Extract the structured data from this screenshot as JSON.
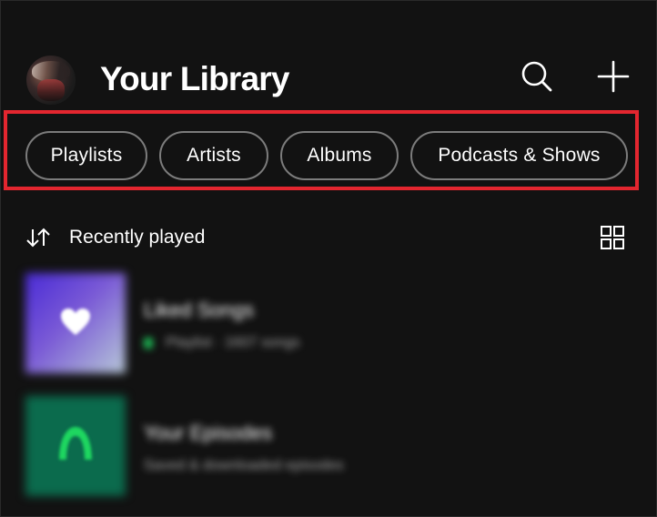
{
  "header": {
    "title": "Your Library",
    "avatar_icon": "user-avatar",
    "search_icon": "search-icon",
    "add_icon": "plus-icon"
  },
  "filters": {
    "chips": [
      {
        "label": "Playlists"
      },
      {
        "label": "Artists"
      },
      {
        "label": "Albums"
      },
      {
        "label": "Podcasts & Shows"
      }
    ]
  },
  "sort": {
    "label": "Recently played",
    "sort_icon": "sort-arrows-icon",
    "view_icon": "grid-view-icon"
  },
  "library_items": [
    {
      "title": "Liked Songs",
      "type": "Playlist",
      "meta": "1607 songs",
      "pinned": true
    },
    {
      "title": "Your Episodes",
      "subtitle": "Saved & downloaded episodes"
    }
  ],
  "colors": {
    "background": "#121212",
    "highlight": "#e3262f",
    "accent_green": "#1db954",
    "chip_border": "#7c7c7c",
    "secondary_text": "#a7a7a7"
  }
}
